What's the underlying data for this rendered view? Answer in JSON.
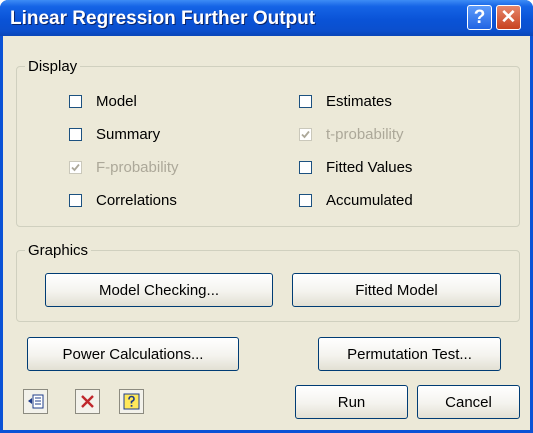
{
  "window": {
    "title": "Linear Regression Further Output"
  },
  "titlebar": {
    "help_icon": "?",
    "close_icon": "✕"
  },
  "display": {
    "legend": "Display",
    "checkboxes": [
      {
        "label": "Model",
        "checked": false,
        "disabled": false
      },
      {
        "label": "Summary",
        "checked": false,
        "disabled": false
      },
      {
        "label": "F-probability",
        "checked": true,
        "disabled": true
      },
      {
        "label": "Correlations",
        "checked": false,
        "disabled": false
      },
      {
        "label": "Estimates",
        "checked": false,
        "disabled": false
      },
      {
        "label": "t-probability",
        "checked": true,
        "disabled": true
      },
      {
        "label": "Fitted Values",
        "checked": false,
        "disabled": false
      },
      {
        "label": "Accumulated",
        "checked": false,
        "disabled": false
      }
    ]
  },
  "graphics": {
    "legend": "Graphics",
    "model_checking_label": "Model Checking...",
    "fitted_model_label": "Fitted Model"
  },
  "buttons": {
    "power_calc_label": "Power Calculations...",
    "permutation_label": "Permutation Test...",
    "run_label": "Run",
    "cancel_label": "Cancel"
  },
  "icons": {
    "paste": "paste-icon",
    "clear": "clear-x-icon",
    "help": "help-icon"
  },
  "colors": {
    "title_bar": "#0a53d7",
    "dialog_bg": "#ece9d8",
    "close_button": "#c8421f",
    "clear_icon": "#c0282d"
  }
}
